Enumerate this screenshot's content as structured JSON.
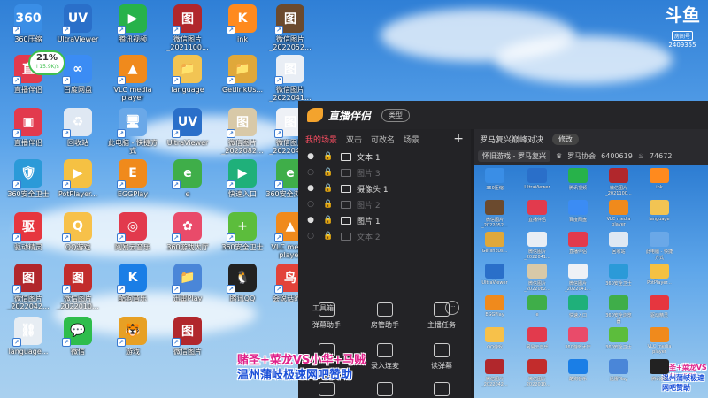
{
  "desktop": {
    "icons": [
      {
        "label": "360压缩",
        "color": "#3a8ee6",
        "glyph": "360"
      },
      {
        "label": "UltraViewer",
        "color": "#2a6fc9",
        "glyph": "UV"
      },
      {
        "label": "腾讯视频",
        "color": "#27b24a",
        "glyph": "▶"
      },
      {
        "label": "微信图片_2021100...",
        "color": "#b1272c",
        "glyph": "图"
      },
      {
        "label": "ink",
        "color": "#ff8a1e",
        "glyph": "K"
      },
      {
        "label": "微信图片_2022052...",
        "color": "#6b4a2e",
        "glyph": "图"
      },
      {
        "label": "直播伴侣",
        "color": "#e23a4d",
        "glyph": "直"
      },
      {
        "label": "百度网盘",
        "color": "#3b8cf4",
        "glyph": "∞"
      },
      {
        "label": "VLC media player",
        "color": "#f08a1c",
        "glyph": "▲"
      },
      {
        "label": "language",
        "color": "#f2c453",
        "glyph": "📁"
      },
      {
        "label": "GetlinkUs...",
        "color": "#e0a83a",
        "glyph": "📁"
      },
      {
        "label": "微信图片_2022041...",
        "color": "#e9eef5",
        "glyph": "图"
      },
      {
        "label": "直播伴侣",
        "color": "#e23a4d",
        "glyph": "▣"
      },
      {
        "label": "回收站",
        "color": "#dfe8f3",
        "glyph": "♻"
      },
      {
        "label": "此电脑 - 快捷方式",
        "color": "#6aa8e8",
        "glyph": "🖥"
      },
      {
        "label": "UltraViewer",
        "color": "#2a6fc9",
        "glyph": "UV"
      },
      {
        "label": "微信图片_2022082...",
        "color": "#d8c9a8",
        "glyph": "图"
      },
      {
        "label": "微信图片_2022041...",
        "color": "#eef1f6",
        "glyph": "图"
      },
      {
        "label": "360安全卫士",
        "color": "#2b9ad8",
        "glyph": "🛡"
      },
      {
        "label": "PotPlayer...",
        "color": "#f5c143",
        "glyph": "▶"
      },
      {
        "label": "EGGPlay",
        "color": "#f08a1c",
        "glyph": "E"
      },
      {
        "label": "e",
        "color": "#3fae49",
        "glyph": "e"
      },
      {
        "label": "快速入口",
        "color": "#1fb07a",
        "glyph": "▶"
      },
      {
        "label": "360安全浏览器",
        "color": "#3fae49",
        "glyph": "e"
      },
      {
        "label": "驱动精灵",
        "color": "#e6363f",
        "glyph": "驱"
      },
      {
        "label": "QQ游戏",
        "color": "#f7c14a",
        "glyph": "Q"
      },
      {
        "label": "网易云音乐",
        "color": "#e23a4d",
        "glyph": "◎"
      },
      {
        "label": "360游戏大厅",
        "color": "#e94b6a",
        "glyph": "✿"
      },
      {
        "label": "360安全卫士",
        "color": "#5cbd3c",
        "glyph": "+"
      },
      {
        "label": "VLC media player",
        "color": "#f08a1c",
        "glyph": "▲"
      },
      {
        "label": "微信图片_2022042...",
        "color": "#b1272c",
        "glyph": "图"
      },
      {
        "label": "微信图片_2022010...",
        "color": "#c22c2c",
        "glyph": "图"
      },
      {
        "label": "酷狗音乐",
        "color": "#1a7ee6",
        "glyph": "K"
      },
      {
        "label": "迅雷Play",
        "color": "#4a86d8",
        "glyph": "📁"
      },
      {
        "label": "腾讯QQ",
        "color": "#222222",
        "glyph": "🐧"
      },
      {
        "label": "会说话的...",
        "color": "#e2433a",
        "glyph": "鸟"
      },
      {
        "label": "language...",
        "color": "#e7edf3",
        "glyph": "⛓"
      },
      {
        "label": "微信",
        "color": "#2fbd4c",
        "glyph": "💬"
      },
      {
        "label": "游戏",
        "color": "#e7a024",
        "glyph": "🐯"
      },
      {
        "label": "微信图片",
        "color": "#b1272c",
        "glyph": "图"
      }
    ],
    "speed_widget": {
      "percent": "21%",
      "rate": "↑15.9K/s"
    },
    "corner_logo": {
      "brand": "斗鱼",
      "tag": "房间号",
      "room": "2409355"
    }
  },
  "app": {
    "name": "直播伴侣",
    "type_button": "类型",
    "scene_tabs": [
      "我的场景",
      "双击",
      "可改名",
      "场景"
    ],
    "add_scene_symbol": "+",
    "sources": [
      {
        "name": "文本 1",
        "active": true,
        "type": "text"
      },
      {
        "name": "图片 3",
        "active": false,
        "type": "image"
      },
      {
        "name": "摄像头 1",
        "active": true,
        "type": "camera"
      },
      {
        "name": "图片 2",
        "active": false,
        "type": "image"
      },
      {
        "name": "图片 1",
        "active": true,
        "type": "image"
      },
      {
        "name": "文本 2",
        "active": false,
        "type": "text"
      }
    ],
    "toolbox": {
      "title": "工具箱",
      "more_symbol": "···",
      "tools": [
        "弹幕助手",
        "房管助手",
        "主播任务",
        "",
        "录入连麦",
        "读弹幕",
        "",
        "",
        ""
      ]
    },
    "preview": {
      "title": "罗马复兴巅峰对决",
      "edit_label": "修改",
      "category": "怀旧游戏 - 罗马复兴",
      "guild": "罗马协会",
      "room_id": "6400619",
      "fans": "74672"
    }
  },
  "overlay": {
    "line1": "赌圣+菜龙VS小华+马贼",
    "line2": "温州蒲岐极速网吧赞助",
    "line1_color": "#e0218a",
    "line2_color": "#1a4fd8"
  }
}
